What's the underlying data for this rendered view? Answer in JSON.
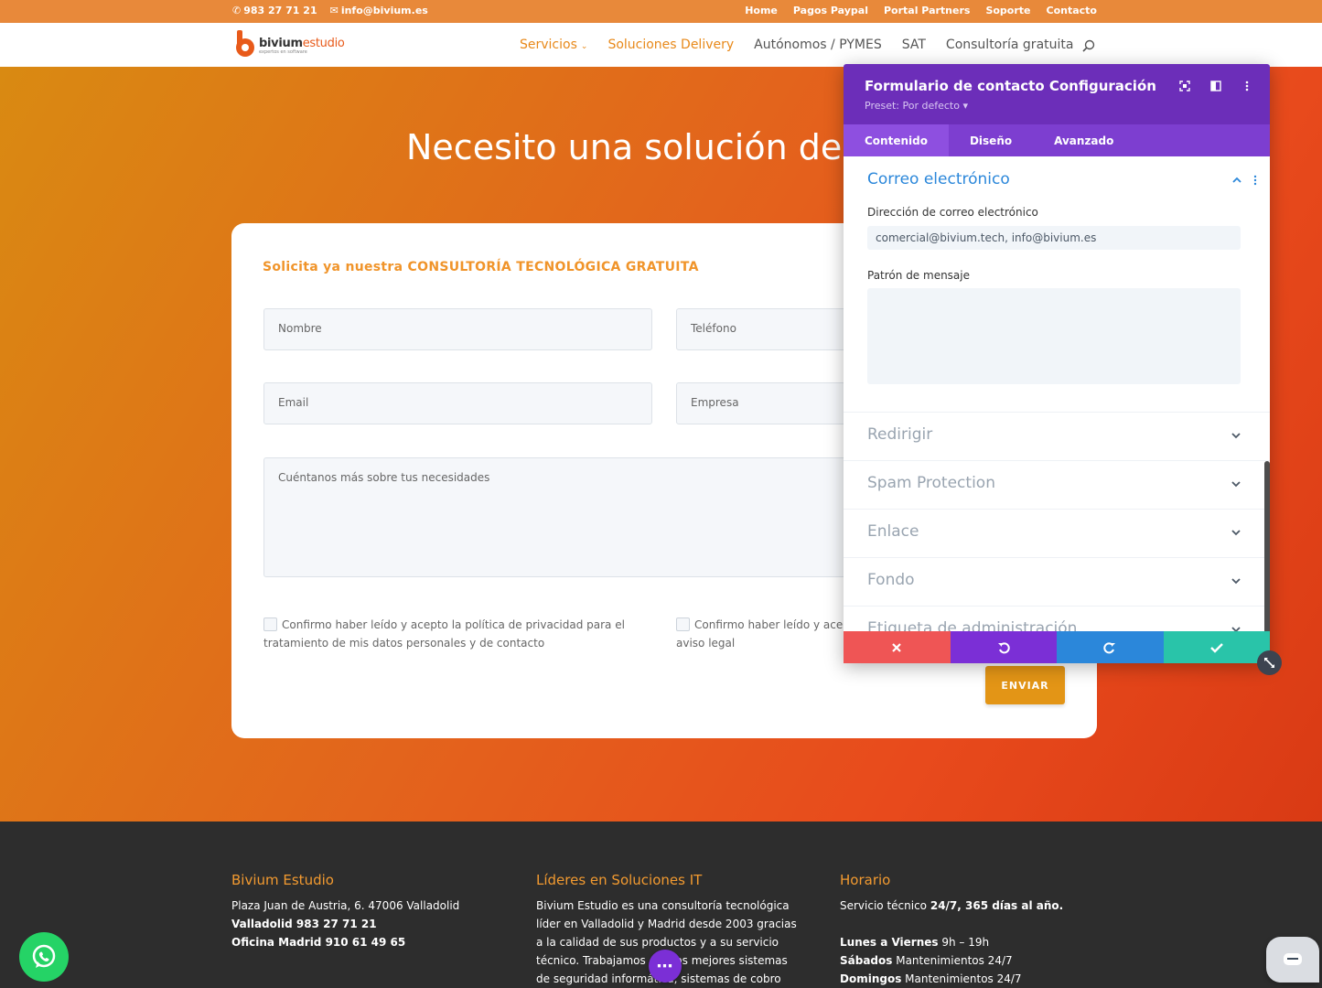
{
  "topbar": {
    "phone": "983 27 71 21",
    "email": "info@bivium.es",
    "links": [
      "Home",
      "Pagos Paypal",
      "Portal Partners",
      "Soporte",
      "Contacto"
    ]
  },
  "logo": {
    "name_bold": "bivium",
    "name_light": "estudio",
    "tagline": "expertos en software"
  },
  "nav": {
    "items": [
      "Servicios",
      "Soluciones Delivery",
      "Autónomos / PYMES",
      "SAT",
      "Consultoría gratuita"
    ]
  },
  "hero": {
    "title": "Necesito una solución delivery"
  },
  "form": {
    "heading_prefix": "Solicita ya nuestra ",
    "heading_strong": "CONSULTORÍA TECNOLÓGICA GRATUITA",
    "name_placeholder": "Nombre",
    "phone_placeholder": "Teléfono",
    "email_placeholder": "Email",
    "company_placeholder": "Empresa",
    "message_placeholder": "Cuéntanos más sobre tus necesidades",
    "privacy_check": "Confirmo haber leído y acepto la política de privacidad para el tratamiento de mis datos personales y de contacto",
    "legal_check_line1": "Confirmo haber leído y acep",
    "legal_check_line2": "aviso legal",
    "submit": "ENVIAR"
  },
  "footer": {
    "col1": {
      "title": "Bivium Estudio",
      "address": "Plaza Juan de Austria, 6. 47006 Valladolid",
      "valladolid": "Valladolid 983 27 71 21",
      "madrid": "Oficina Madrid 910 61 49 65"
    },
    "col2": {
      "title": "Líderes en Soluciones IT",
      "text": "Bivium Estudio es una consultoría tecnológica líder en Valladolid y Madrid desde 2003 gracias a la calidad de sus productos y a su servicio técnico. Trabajamos con los mejores sistemas de seguridad informática, sistemas de cobro"
    },
    "col3": {
      "title": "Horario",
      "service_prefix": "Servicio técnico ",
      "service_strong": "24/7, 365 días al año.",
      "weekdays_label": "Lunes a Viernes",
      "weekdays_value": " 9h – 19h",
      "saturday_label": "Sábados",
      "saturday_value": " Mantenimientos 24/7",
      "sunday_label": "Domingos",
      "sunday_value": " Mantenimientos 24/7"
    }
  },
  "panel": {
    "title": "Formulario de contacto Configuración",
    "preset": "Preset: Por defecto ▾",
    "tabs": [
      "Contenido",
      "Diseño",
      "Avanzado"
    ],
    "active_tab": "Contenido",
    "open_section": "Correo electrónico",
    "email_label": "Dirección de correo electrónico",
    "email_value": "comercial@bivium.tech, info@bivium.es",
    "pattern_label": "Patrón de mensaje",
    "pattern_value": "",
    "sections": [
      "Redirigir",
      "Spam Protection",
      "Enlace",
      "Fondo",
      "Etiqueta de administración"
    ]
  },
  "colors": {
    "topbar": "#e8893a",
    "brand_orange": "#e85a1a",
    "panel_purple": "#6c2eb9",
    "panel_tab_purple": "#7d3ed0",
    "cancel_red": "#ef5555",
    "undo_purple": "#7b2fd6",
    "redo_blue": "#2b87da",
    "save_green": "#29c4a9",
    "link_blue": "#2b87da"
  },
  "icons": [
    "phone-icon",
    "envelope-icon",
    "search-icon",
    "chevron-down-icon",
    "whatsapp-icon",
    "chat-icon",
    "more-dots-icon",
    "fullscreen-icon",
    "split-view-icon",
    "kebab-icon",
    "close-icon",
    "undo-icon",
    "redo-icon",
    "check-icon",
    "resize-icon",
    "chevron-up-icon"
  ]
}
